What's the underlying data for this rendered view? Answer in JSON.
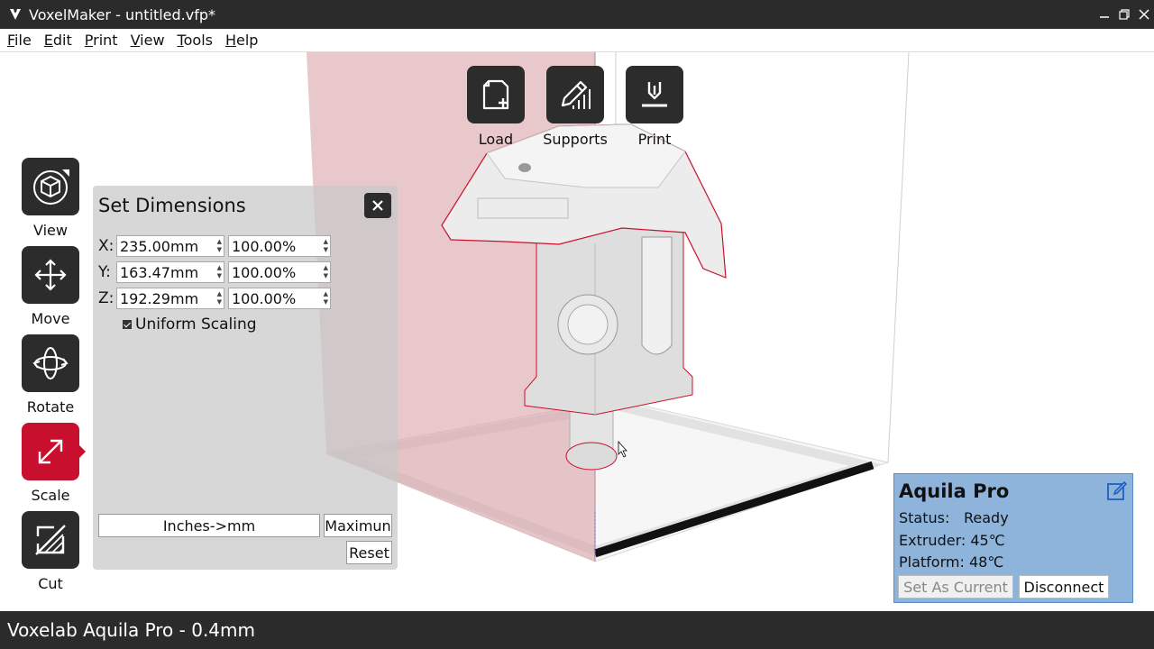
{
  "window": {
    "title": "VoxelMaker - untitled.vfp*"
  },
  "menu": [
    {
      "u": "F",
      "rest": "ile"
    },
    {
      "u": "E",
      "rest": "dit"
    },
    {
      "u": "P",
      "rest": "rint"
    },
    {
      "u": "V",
      "rest": "iew"
    },
    {
      "u": "T",
      "rest": "ools"
    },
    {
      "u": "H",
      "rest": "elp"
    }
  ],
  "top_toolbar": {
    "load": "Load",
    "supports": "Supports",
    "print": "Print"
  },
  "left_toolbar": {
    "view": "View",
    "move": "Move",
    "rotate": "Rotate",
    "scale": "Scale",
    "cut": "Cut",
    "active": "scale"
  },
  "dimensions": {
    "title": "Set Dimensions",
    "rows": [
      {
        "axis": "X:",
        "mm": "235.00mm",
        "pct": "100.00%"
      },
      {
        "axis": "Y:",
        "mm": "163.47mm",
        "pct": "100.00%"
      },
      {
        "axis": "Z:",
        "mm": "192.29mm",
        "pct": "100.00%"
      }
    ],
    "uniform_label": "Uniform Scaling",
    "uniform_checked": true,
    "inches_btn": "Inches->mm",
    "max_btn": "Maximun",
    "reset_btn": "Reset"
  },
  "printer": {
    "name": "Aquila Pro",
    "status_label": "Status:",
    "status_value": "Ready",
    "extruder_label": "Extruder:",
    "extruder_value": "45℃",
    "platform_label": "Platform:",
    "platform_value": "48℃",
    "set_current": "Set As Current",
    "disconnect": "Disconnect"
  },
  "statusbar": {
    "text": "Voxelab Aquila Pro - 0.4mm"
  },
  "colors": {
    "accent": "#c8102e",
    "toolbar": "#2c2c2c",
    "printer_panel": "#8fb4dc",
    "chrome": "#2b2b2b"
  }
}
